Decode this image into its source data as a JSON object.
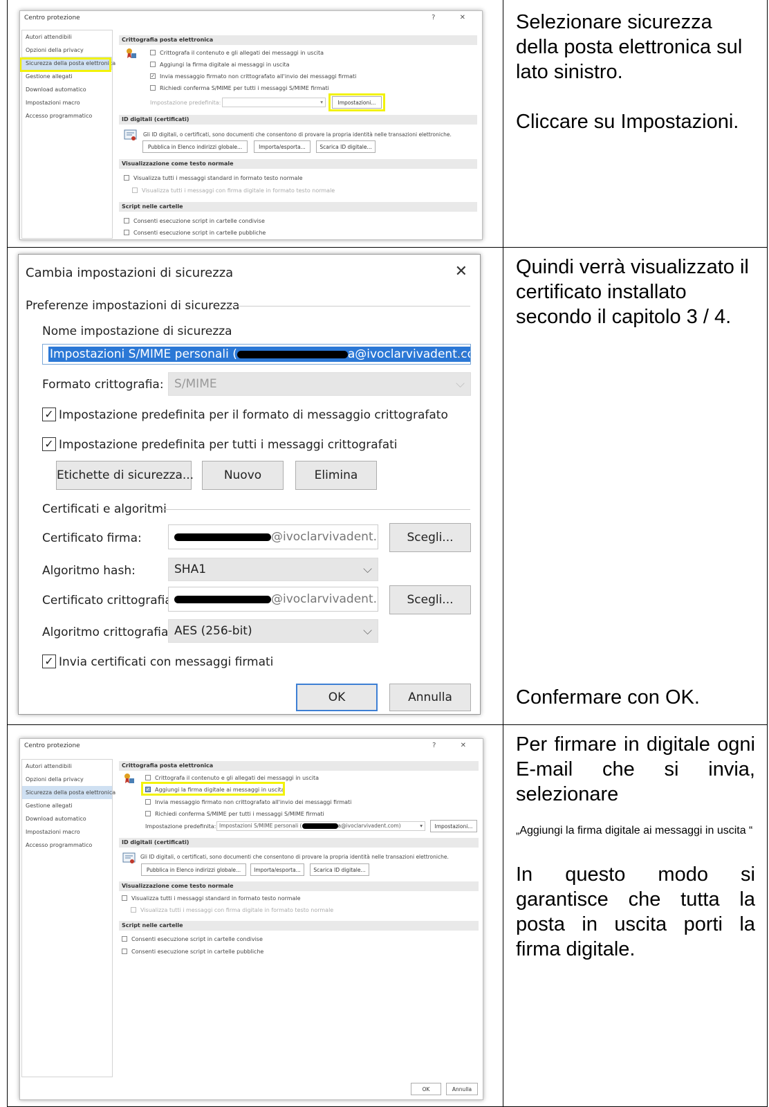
{
  "instructions": {
    "row1": [
      "Selezionare sicurezza della posta elettronica sul lato sinistro.",
      "Cliccare su Impostazioni."
    ],
    "row2_top": "Quindi verrà visualizzato il certificato installato secondo il capitolo 3 / 4.",
    "row2_bottom": "Confermare con OK.",
    "row3_a": "Per firmare in digitale ogni E-mail che si invia, selezionare",
    "row3_quote": "„Aggiungi la firma digitale ai messaggi in uscita “",
    "row3_b": "In questo modo si garantisce che tutta la posta in uscita porti la firma digitale."
  },
  "trust_center": {
    "title": "Centro protezione",
    "controls": "?  ✕",
    "nav": [
      "Autori attendibili",
      "Opzioni della privacy",
      "Sicurezza della posta elettronica",
      "Gestione allegati",
      "Download automatico",
      "Impostazioni macro",
      "Accesso programmatico"
    ],
    "section_crypto": "Crittografia posta elettronica",
    "opt_encrypt": "Crittografa il contenuto e gli allegati dei messaggi in uscita",
    "opt_sign": "Aggiungi la firma digitale ai messaggi in uscita",
    "opt_cleartext": "Invia messaggio firmato non crittografato all'invio dei messaggi firmati",
    "opt_receipt": "Richiedi conferma S/MIME per tutti i messaggi S/MIME firmati",
    "default_setting_label": "Impostazione predefinita:",
    "default_setting_value_2": "Impostazioni S/MIME personali (",
    "default_setting_value_2_tail": "a@ivoclarvivadent.com)",
    "settings_button": "Impostazioni...",
    "section_ids": "ID digitali (certificati)",
    "ids_text": "Gli ID digitali, o certificati, sono documenti che consentono di provare la propria identità nelle transazioni elettroniche.",
    "publish_button": "Pubblica in Elenco indirizzi globale...",
    "import_button": "Importa/esporta...",
    "get_id_button": "Scarica ID digitale...",
    "section_plain": "Visualizzazione come testo normale",
    "plain_all": "Visualizza tutti i messaggi standard in formato testo normale",
    "plain_signed": "Visualizza tutti i messaggi con firma digitale in formato testo normale",
    "section_scripts": "Script nelle cartelle",
    "script_shared": "Consenti esecuzione script in cartelle condivise",
    "script_public": "Consenti esecuzione script in cartelle pubbliche",
    "ok": "OK",
    "cancel": "Annulla"
  },
  "security_settings": {
    "title": "Cambia impostazioni di sicurezza",
    "close": "✕",
    "group_prefs": "Preferenze impostazioni di sicurezza",
    "name_label": "Nome impostazione di sicurezza",
    "name_value_head": "Impostazioni S/MIME personali (",
    "name_value_tail": "a@ivoclarvivadent.com)",
    "format_label": "Formato crittografia:",
    "format_value": "S/MIME",
    "cb_default_format": "Impostazione predefinita per il formato di messaggio crittografato",
    "cb_default_all": "Impostazione predefinita per tutti i messaggi crittografati",
    "btn_labels": "Etichette di sicurezza...",
    "btn_new": "Nuovo",
    "btn_delete": "Elimina",
    "group_certs": "Certificati e algoritmi",
    "sign_cert_label": "Certificato firma:",
    "sign_cert_value": "@ivoclarvivadent.com",
    "choose": "Scegli...",
    "hash_label": "Algoritmo hash:",
    "hash_value": "SHA1",
    "enc_cert_label": "Certificato crittografia:",
    "enc_cert_value": "@ivoclarvivadent.com",
    "enc_alg_label": "Algoritmo crittografia:",
    "enc_alg_value": "AES (256-bit)",
    "cb_send_certs": "Invia certificati con messaggi firmati",
    "ok": "OK",
    "cancel": "Annulla"
  }
}
